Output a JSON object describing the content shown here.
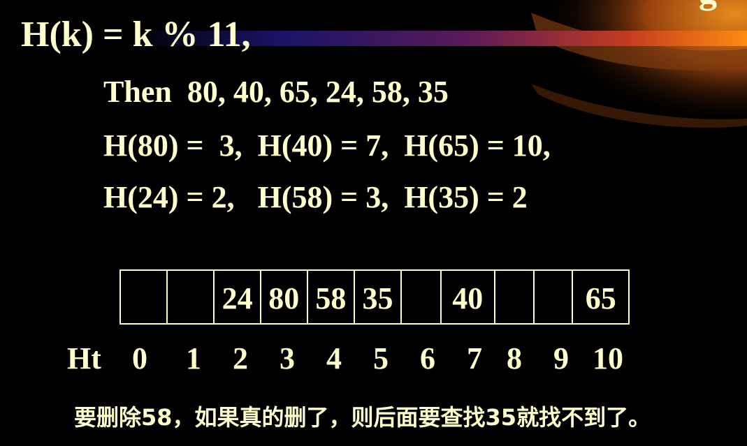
{
  "slide": {
    "corner_glyph": "g",
    "title": "H(k) = k % 11,",
    "lines": [
      "Then  80, 40, 65, 24, 58, 35",
      "H(80) =  3,  H(40) = 7,  H(65) = 10,",
      "H(24) = 2,   H(58) = 3,  H(35) = 2"
    ],
    "table_label": "Ht",
    "table": {
      "cells": [
        "",
        "",
        "24",
        "80",
        "58",
        "35",
        "",
        "40",
        "",
        "",
        "65"
      ],
      "indices": [
        "0",
        "1",
        "2",
        "3",
        "4",
        "5",
        "6",
        "7",
        "8",
        "9",
        "10"
      ]
    },
    "note": "要删除58，如果真的删了，则后面要查找35就找不到了。"
  }
}
